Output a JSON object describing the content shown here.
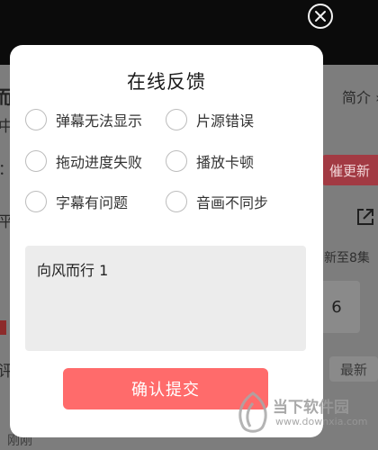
{
  "background": {
    "intro_label": "简介 ›",
    "update_button": "催更新",
    "episode_info": "新至8集",
    "episode_number": "6",
    "latest_label": "最新",
    "bottom_text": "刚刚",
    "left_glyphs": [
      "而",
      "中",
      "：",
      "平",
      "评"
    ]
  },
  "modal": {
    "title": "在线反馈",
    "options": [
      {
        "label": "弹幕无法显示",
        "checked": false
      },
      {
        "label": "片源错误",
        "checked": false
      },
      {
        "label": "拖动进度失败",
        "checked": false
      },
      {
        "label": "播放卡顿",
        "checked": false
      },
      {
        "label": "字幕有问题",
        "checked": false
      },
      {
        "label": "音画不同步",
        "checked": false
      }
    ],
    "feedback_text": "向风而行 1",
    "submit_label": "确认提交"
  },
  "watermark": {
    "name": "当下软件园",
    "url": "www.downxia.com"
  },
  "colors": {
    "submit_button": "#ff6b6b",
    "textarea_bg": "#ececec",
    "overlay": "#7d7d7d"
  }
}
